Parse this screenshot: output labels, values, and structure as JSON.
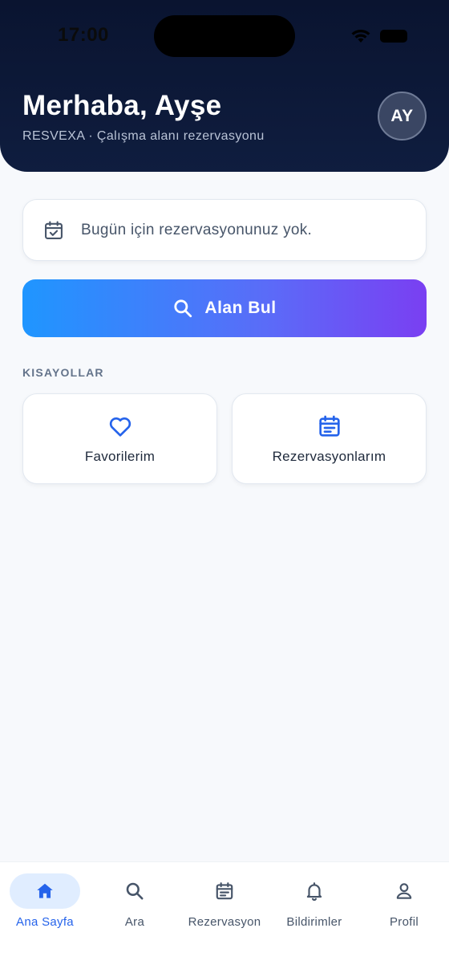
{
  "status_bar": {
    "time": "17:00"
  },
  "header": {
    "greeting": "Merhaba, Ayşe",
    "subtitle": "RESVEXA · Çalışma alanı rezervasyonu",
    "avatar_initials": "AY"
  },
  "today": {
    "icon": "calendar-check-icon",
    "message": "Bugün için rezervasyonunuz yok."
  },
  "search_button": {
    "icon": "search-icon",
    "label": "Alan Bul"
  },
  "shortcuts": {
    "title": "KISAYOLLAR",
    "items": [
      {
        "label": "Favorilerim",
        "icon": "heart-icon"
      },
      {
        "label": "Rezervasyonlarım",
        "icon": "calendar-list-icon"
      }
    ]
  },
  "tabs": [
    {
      "label": "Ana Sayfa",
      "icon": "home-icon",
      "active": true
    },
    {
      "label": "Ara",
      "icon": "search-icon",
      "active": false
    },
    {
      "label": "Rezervasyon",
      "icon": "calendar-list-icon",
      "active": false
    },
    {
      "label": "Bildirimler",
      "icon": "bell-icon",
      "active": false
    },
    {
      "label": "Profil",
      "icon": "person-icon",
      "active": false
    }
  ],
  "colors": {
    "header_bg": "#0a1430",
    "accent_blue": "#2563eb",
    "gradient_start": "#1f96ff",
    "gradient_end": "#7a3ff2"
  }
}
